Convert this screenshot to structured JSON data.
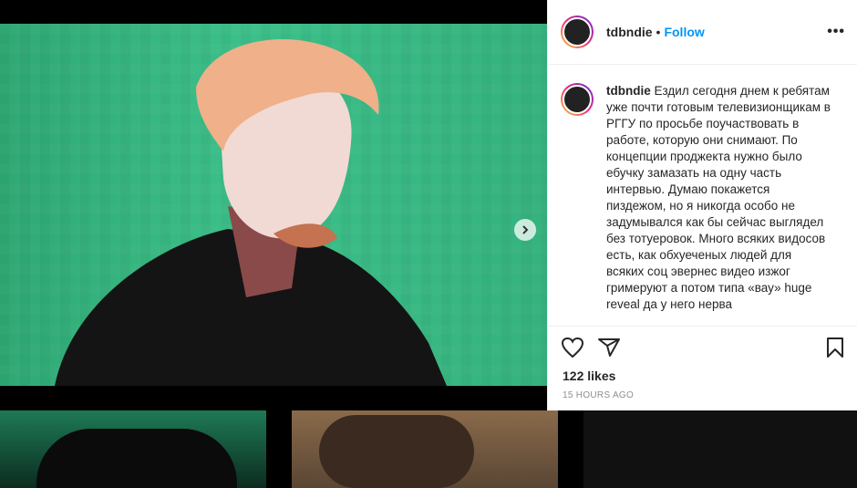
{
  "post": {
    "username": "tdbndie",
    "separator": "•",
    "follow_label": "Follow",
    "more_label": "•••",
    "caption": "Ездил сегодня днем к ребятам уже почти готовым телевизионщикам в РГГУ по просьбе поучаствовать в работе, которую они снимают. По концепции проджекта нужно было ебучку замазать на одну часть интервью. Думаю покажется пиздежом, но я никогда особо не задумывался как бы сейчас выглядел без тотуеровок. Много всяких видосов есть, как обхуеченых людей для всяких соц эвернес видео изжог гримеруют а потом типа «вау» huge reveal да у него нерва",
    "likes": "122 likes",
    "time": "15 HOURS AGO"
  },
  "carousel": {
    "dots": 3,
    "active_index": 0,
    "next_icon": "chevron-right-icon"
  },
  "icons": {
    "like": "heart-icon",
    "share": "paper-plane-icon",
    "save": "bookmark-icon"
  },
  "colors": {
    "accent": "#0095f6",
    "text": "#262626",
    "muted": "#8e8e8e"
  }
}
